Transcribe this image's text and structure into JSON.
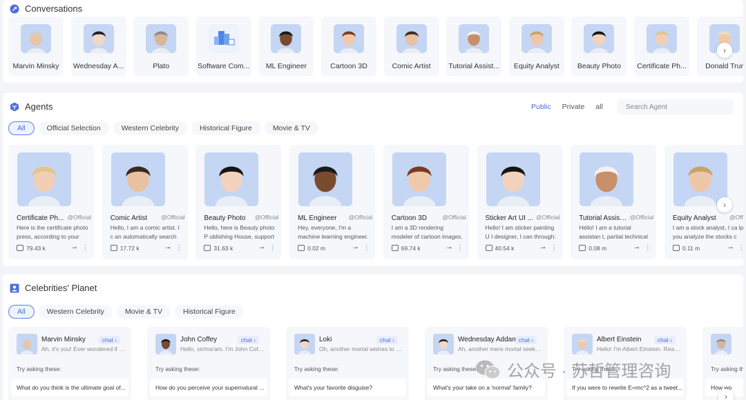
{
  "conversations": {
    "title": "Conversations",
    "items": [
      {
        "name": "Marvin Minsky",
        "color": "#d8dfe8"
      },
      {
        "name": "Wednesday A...",
        "color": "#e4e6ea"
      },
      {
        "name": "Plato",
        "color": "#d6dde6"
      },
      {
        "name": "Software Com...",
        "color": "#e8eef8"
      },
      {
        "name": "ML Engineer",
        "color": "#cfdcf3"
      },
      {
        "name": "Cartoon 3D",
        "color": "#d4def2"
      },
      {
        "name": "Comic Artist",
        "color": "#c6d8f3"
      },
      {
        "name": "Tutorial Assist...",
        "color": "#d2ddf0"
      },
      {
        "name": "Equity Analyst",
        "color": "#c7d9f3"
      },
      {
        "name": "Beauty Photo",
        "color": "#d2dcf2"
      },
      {
        "name": "Certificate Ph...",
        "color": "#d4def2"
      },
      {
        "name": "Donald Trur",
        "color": "#cddcf3"
      }
    ]
  },
  "agents": {
    "title": "Agents",
    "visibility": [
      "Public",
      "Private",
      "all"
    ],
    "active_visibility": "Public",
    "search_placeholder": "Search Agent",
    "filters": [
      "All",
      "Official Selection",
      "Western Celebrity",
      "Historical Figure",
      "Movie & TV"
    ],
    "cards": [
      {
        "name": "Certificate Ph...",
        "badge": "@Official",
        "desc": "Here is the certificate photo press, according to your nat...",
        "count": "79.43 k"
      },
      {
        "name": "Comic Artist",
        "badge": "@Official",
        "desc": "Hello, I am a comic artist. I c an automatically search the...",
        "count": "17.72 k"
      },
      {
        "name": "Beauty Photo",
        "badge": "@Official",
        "desc": "Hello, here is Beauty photo P ublishing House, support a ...",
        "count": "31.63 k"
      },
      {
        "name": "ML Engineer",
        "badge": "@Official",
        "desc": "Hey, everyone, I'm a machine learning engineer. You can ...",
        "count": "0.02 m"
      },
      {
        "name": "Cartoon 3D",
        "badge": "@Official",
        "desc": "I am a 3D rendering modeler of cartoon images. I can as...",
        "count": "69.74 k"
      },
      {
        "name": "Sticker Art UI ...",
        "badge": "@Official",
        "desc": "Hello! I am sticker painting U I designer, I can through: sti...",
        "count": "40.54 k"
      },
      {
        "name": "Tutorial Assist...",
        "badge": "@Official",
        "desc": "Hello! I am a tutorial assistan t, partial technical theme, th...",
        "count": "0.08 m"
      },
      {
        "name": "Equity Analyst",
        "badge": "@Offic",
        "desc": "I am a stock analyst, I ca lp you analyze the stocks c",
        "count": "0.11 m"
      }
    ]
  },
  "celebrities": {
    "title": "Celebrities' Planet",
    "filters": [
      "All",
      "Western Celebrity",
      "Movie & TV",
      "Historical Figure"
    ],
    "chat_label": "chat",
    "try_label": "Try asking these:",
    "cards": [
      {
        "name": "Marvin Minsky",
        "msg": "Ah, it's you! Ever wondered if machi...",
        "question": "What do you think is the ultimate goal of..."
      },
      {
        "name": "John Coffey",
        "msg": "Hello, sir/ma'am. I'm John Coffey, li...",
        "question": "How do you perceive your supernatural ..."
      },
      {
        "name": "Loki",
        "msg": "Oh, another mortal wishes to conve...",
        "question": "What's your favorite disguise?"
      },
      {
        "name": "Wednesday Addams",
        "msg": "Ah, another mere mortal seeking co...",
        "question": "What's your take on a 'normal' family?"
      },
      {
        "name": "Albert Einstein",
        "msg": "Hello! I'm Albert Einstein. Ready to ...",
        "question": "If you were to rewrite E=mc^2 as a tweet..."
      },
      {
        "name": "",
        "msg": "",
        "question": "How wo"
      }
    ]
  },
  "watermark": {
    "text": "公众号 · 苏哲管理咨询"
  },
  "colors": {
    "accent": "#4a6ad8",
    "card_bg": "#f5f7fa",
    "avatar_bg": "#c9daf6"
  }
}
